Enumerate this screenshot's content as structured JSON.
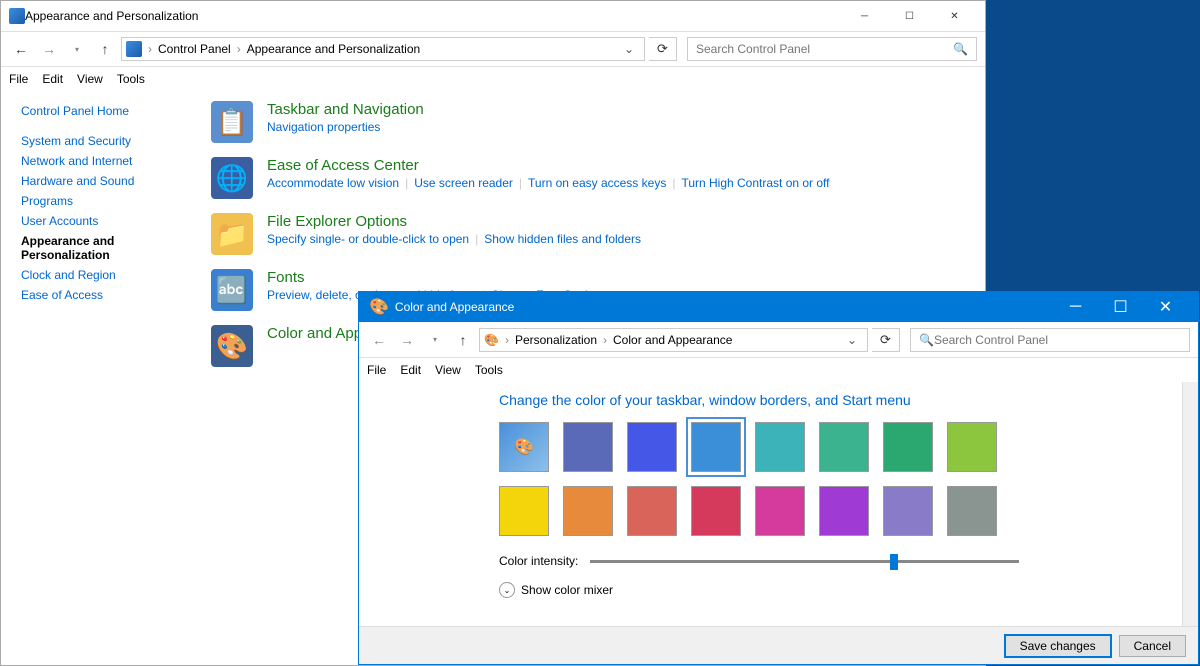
{
  "mainWindow": {
    "title": "Appearance and Personalization",
    "breadcrumb": {
      "root": "Control Panel",
      "current": "Appearance and Personalization"
    },
    "searchPlaceholder": "Search Control Panel",
    "menu": {
      "file": "File",
      "edit": "Edit",
      "view": "View",
      "tools": "Tools"
    },
    "sidebar": {
      "home": "Control Panel Home",
      "items": [
        "System and Security",
        "Network and Internet",
        "Hardware and Sound",
        "Programs",
        "User Accounts",
        "Appearance and Personalization",
        "Clock and Region",
        "Ease of Access"
      ]
    },
    "categories": [
      {
        "title": "Taskbar and Navigation",
        "links": [
          "Navigation properties"
        ]
      },
      {
        "title": "Ease of Access Center",
        "links": [
          "Accommodate low vision",
          "Use screen reader",
          "Turn on easy access keys",
          "Turn High Contrast on or off"
        ]
      },
      {
        "title": "File Explorer Options",
        "links": [
          "Specify single- or double-click to open",
          "Show hidden files and folders"
        ]
      },
      {
        "title": "Fonts",
        "links": [
          "Preview, delete, or show and hide fonts",
          "Change Font Settings"
        ]
      },
      {
        "title": "Color and Appearance",
        "links": []
      }
    ]
  },
  "subWindow": {
    "title": "Color and Appearance",
    "breadcrumb": {
      "root": "Personalization",
      "current": "Color and Appearance"
    },
    "searchPlaceholder": "Search Control Panel",
    "menu": {
      "file": "File",
      "edit": "Edit",
      "view": "View",
      "tools": "Tools"
    },
    "heading": "Change the color of your taskbar, window borders, and Start menu",
    "swatches": [
      "auto",
      "#5b6ab8",
      "#4457e6",
      "#3b8fd8",
      "#3bb3b8",
      "#3bb38f",
      "#2aa86f",
      "#8cc63f",
      "#f4d50c",
      "#e88a3c",
      "#d96459",
      "#d53a5c",
      "#d53a9d",
      "#a03ad5",
      "#8a7bc8",
      "#8a9490"
    ],
    "selectedIndex": 3,
    "intensityLabel": "Color intensity:",
    "intensityPercent": 70,
    "mixerLabel": "Show color mixer",
    "buttons": {
      "save": "Save changes",
      "cancel": "Cancel"
    }
  }
}
